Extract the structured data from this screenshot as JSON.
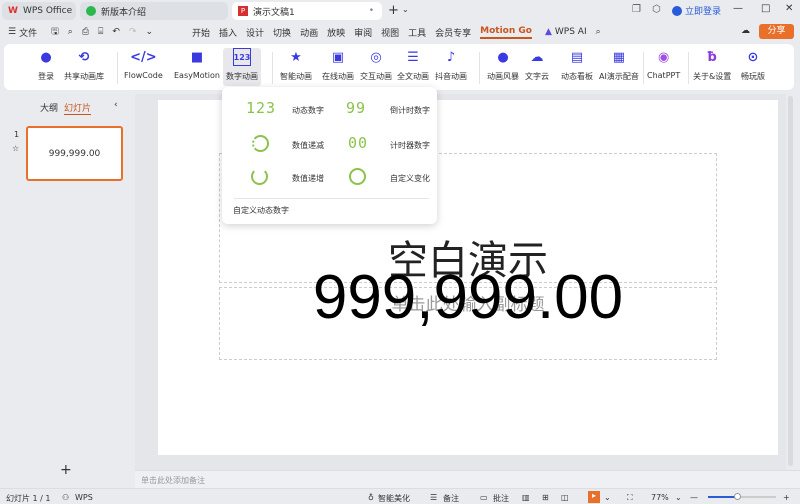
{
  "tabs": [
    {
      "label": "WPS Office"
    },
    {
      "label": "新版本介绍"
    },
    {
      "label": "演示文稿1"
    }
  ],
  "titlebar": {
    "login": "立即登录",
    "share": "分享"
  },
  "menu": {
    "file": "文件",
    "items": [
      "开始",
      "插入",
      "设计",
      "切换",
      "动画",
      "放映",
      "审阅",
      "视图",
      "工具",
      "会员专享"
    ],
    "active": "Motion Go",
    "wps_ai": "WPS AI"
  },
  "ribbon": {
    "items": [
      "登录",
      "共享动画库",
      "FlowCode",
      "EasyMotion",
      "数字动画",
      "智能动画",
      "在线动画",
      "交互动画",
      "全文动画",
      "抖音动画",
      "动画风暴",
      "文字云",
      "动态看板",
      "AI演示配音",
      "ChatPPT",
      "关于&设置",
      "畅玩版"
    ]
  },
  "dropdown": {
    "items": [
      {
        "glyph": "123",
        "label": "动态数字"
      },
      {
        "glyph": "99",
        "label": "倒计时数字"
      },
      {
        "label": "数值递减"
      },
      {
        "glyph": "00",
        "label": "计时器数字"
      },
      {
        "label": "数值递增"
      },
      {
        "label": "自定义变化"
      }
    ],
    "footer": "自定义动态数字"
  },
  "panel": {
    "tabs": [
      "大纲",
      "幻灯片"
    ],
    "slide_number": "1",
    "thumb_text": "999,999.00"
  },
  "slide": {
    "title": "空白演示",
    "subtitle": "单击此处输入副标题",
    "number": "999,999.00"
  },
  "notes": {
    "placeholder": "单击此处添加备注"
  },
  "status": {
    "slide": "幻灯片 1 / 1",
    "wps": "WPS",
    "beautify": "智能美化",
    "notes": "备注",
    "comments": "批注",
    "zoom": "77%"
  }
}
